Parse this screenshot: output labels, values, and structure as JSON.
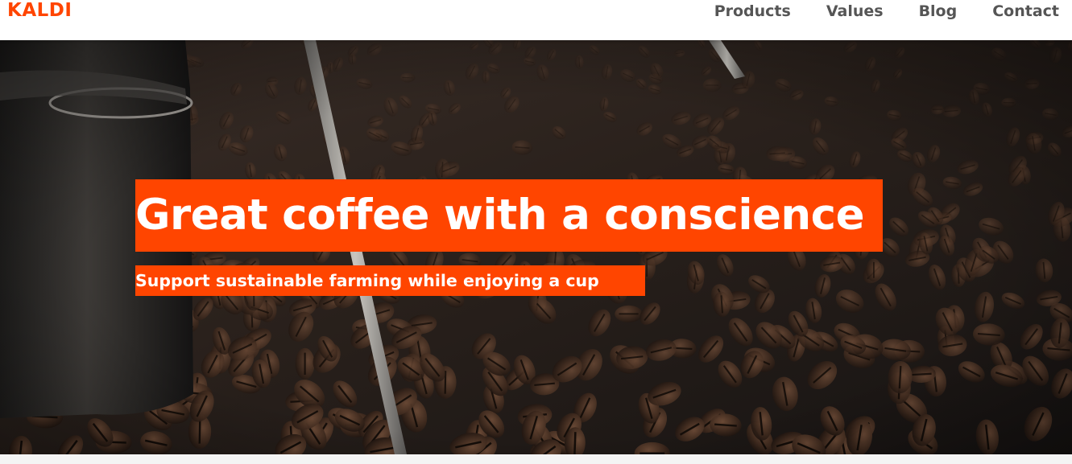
{
  "brand": {
    "name": "KALDI",
    "color": "#ff4500"
  },
  "nav": {
    "items": [
      {
        "label": "Products"
      },
      {
        "label": "Values"
      },
      {
        "label": "Blog"
      },
      {
        "label": "Contact"
      }
    ]
  },
  "hero": {
    "title": "Great coffee with a conscience",
    "subtitle": "Support sustainable farming while enjoying a cup",
    "highlight_color": "#ff4500"
  }
}
